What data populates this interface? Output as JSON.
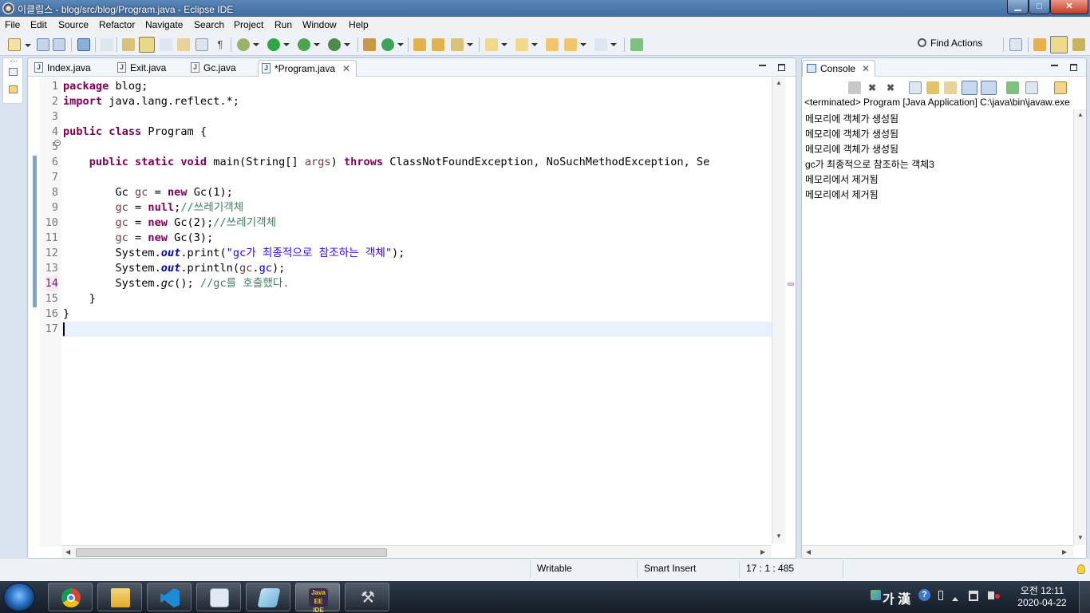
{
  "window": {
    "title": "이클립스 - blog/src/blog/Program.java - Eclipse IDE",
    "minimize_glyph": "▁",
    "maximize_glyph": "□",
    "close_glyph": "✕"
  },
  "menu": [
    "File",
    "Edit",
    "Source",
    "Refactor",
    "Navigate",
    "Search",
    "Project",
    "Run",
    "Window",
    "Help"
  ],
  "toolbar": {
    "find_actions_label": "Find Actions"
  },
  "editor": {
    "tabs": [
      {
        "label": "Index.java",
        "active": false
      },
      {
        "label": "Exit.java",
        "active": false
      },
      {
        "label": "Gc.java",
        "active": false
      },
      {
        "label": "*Program.java",
        "active": true
      }
    ],
    "tab_icon_glyph": "J",
    "close_glyph": "✕",
    "line_numbers": [
      "1",
      "2",
      "3",
      "4",
      "5",
      "6",
      "7",
      "8",
      "9",
      "10",
      "11",
      "12",
      "13",
      "14",
      "15",
      "16",
      "17"
    ],
    "fold_glyph": "−",
    "code": {
      "l1_kw": "package",
      "l1_rest": " blog;",
      "l2_kw": "import",
      "l2_rest": " java.lang.reflect.*;",
      "l4_kw1": "public",
      "l4_kw2": "class",
      "l4_rest": " Program {",
      "l6_indent": "    ",
      "l6_kw1": "public",
      "l6_kw2": "static",
      "l6_kw3": "void",
      "l6_mid": " main(String[] ",
      "l6_param": "args",
      "l6_sp": ") ",
      "l6_kw4": "throws",
      "l6_rest": " ClassNotFoundException, NoSuchMethodException, Se",
      "l8_indent": "        ",
      "l8_a": "Gc ",
      "l8_var": "gc",
      "l8_b": " = ",
      "l8_kw": "new",
      "l8_c": " Gc(1);",
      "l9_indent": "        ",
      "l9_var": "gc",
      "l9_b": " = ",
      "l9_kw": "null",
      "l9_c": ";",
      "l9_cm": "//쓰레기객체",
      "l10_indent": "        ",
      "l10_var": "gc",
      "l10_b": " = ",
      "l10_kw": "new",
      "l10_c": " Gc(2);",
      "l10_cm": "//쓰레기객체",
      "l11_indent": "        ",
      "l11_var": "gc",
      "l11_b": " = ",
      "l11_kw": "new",
      "l11_c": " Gc(3);",
      "l12_indent": "        ",
      "l12_a": "System.",
      "l12_field": "out",
      "l12_b": ".print(",
      "l12_str": "\"gc가 최종적으로 참조하는 객체\"",
      "l12_c": ");",
      "l13_indent": "        ",
      "l13_a": "System.",
      "l13_field": "out",
      "l13_b": ".println(",
      "l13_var": "gc",
      "l13_dot": ".",
      "l13_f": "gc",
      "l13_c": ");",
      "l14_indent": "        ",
      "l14_a": "System.",
      "l14_m": "gc",
      "l14_b": "(); ",
      "l14_cm": "//gc를 호출했다.",
      "l15": "    }",
      "l16": "}"
    }
  },
  "console": {
    "tab_label": "Console",
    "close_glyph": "✕",
    "header": "<terminated> Program [Java Application] C:\\java\\bin\\javaw.exe",
    "output": [
      "메모리에 객체가 생성됨",
      "메모리에 객체가 생성됨",
      "메모리에 객체가 생성됨",
      "gc가 최종적으로 참조하는 객체3",
      "메모리에서 제거됨",
      "메모리에서 제거됨"
    ]
  },
  "status": {
    "writable": "Writable",
    "insert_mode": "Smart Insert",
    "position": "17 : 1 : 485"
  },
  "taskbar": {
    "apps": [
      "chrome-icon",
      "folder-icon",
      "vscode-icon",
      "media-icon",
      "notepad-icon",
      "eclipse-icon",
      "tools-icon"
    ],
    "eclipse_label": "Java EE IDE",
    "tools_glyph": "⚒",
    "ime_label": "가 漢",
    "help_glyph": "?",
    "time": "오전 12:11",
    "date": "2020-04-22"
  },
  "colors": {
    "keyword": "#7f0055",
    "comment": "#3f7f5f",
    "string": "#2a00ff",
    "field": "#0000c0",
    "current_line": "#e8f2fe"
  }
}
